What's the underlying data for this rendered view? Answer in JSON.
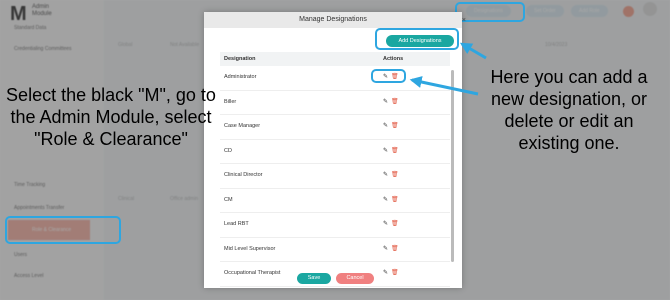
{
  "app": {
    "logo": "M",
    "title_line1": "Admin",
    "title_line2": "Module"
  },
  "sidebar": {
    "items": [
      {
        "label": "Standard Data"
      },
      {
        "label": "Credentialing Committees"
      },
      {
        "label": "Time Tracking"
      },
      {
        "label": "Appointments Transfer"
      },
      {
        "label": "Role & Clearance"
      },
      {
        "label": "Users"
      },
      {
        "label": "Access Level"
      }
    ]
  },
  "topbar": {
    "designations": "Designations",
    "set_order": "Set Order",
    "add_role": "Add Role"
  },
  "background_text": {
    "global": "Global",
    "not_available": "Not Available",
    "clinical": "Clinical",
    "office_admin": "Office admin",
    "date": "10/4/2023"
  },
  "modal": {
    "title": "Manage Designations",
    "close": "×",
    "add_button": "Add Designations",
    "columns": {
      "designation": "Designation",
      "actions": "Actions"
    },
    "rows": [
      {
        "name": "Administrator"
      },
      {
        "name": "Biller"
      },
      {
        "name": "Case Manager"
      },
      {
        "name": "CD"
      },
      {
        "name": "Clinical Director"
      },
      {
        "name": "CM"
      },
      {
        "name": "Lead RBT"
      },
      {
        "name": "Mid Level Supervisor"
      },
      {
        "name": "Occupational Therapist"
      }
    ],
    "save": "Save",
    "cancel": "Cancel"
  },
  "annotations": {
    "left": "Select the black \"M\", go to the Admin Module, select \"Role & Clearance\"",
    "right": "Here you can add a new designation, or delete or edit an existing one."
  },
  "colors": {
    "highlight": "#2ea6e0",
    "teal": "#1aa7a1",
    "cancel": "#f08080",
    "delete": "#e0523b"
  }
}
